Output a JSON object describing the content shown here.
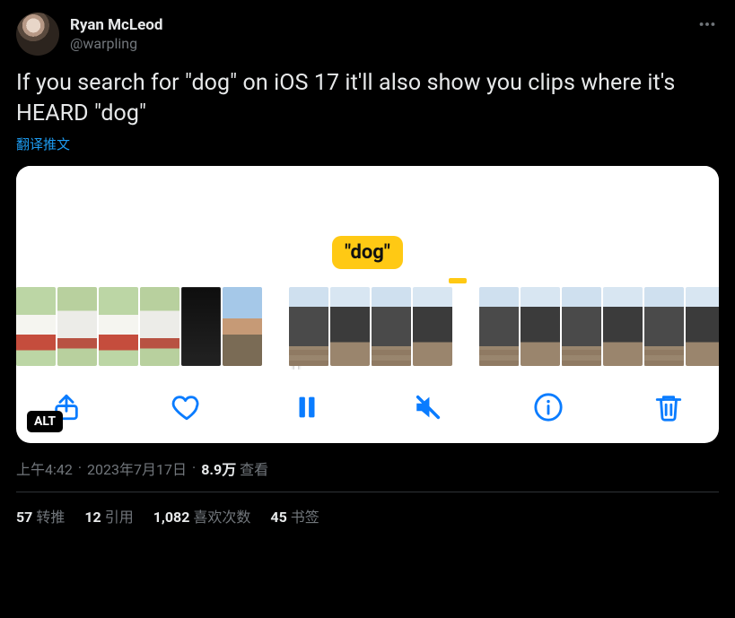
{
  "user": {
    "display_name": "Ryan McLeod",
    "handle": "@warpling"
  },
  "tweet": {
    "text": "If you search for \"dog\" on iOS 17 it'll also show you clips where it's HEARD \"dog\"",
    "translate_label": "翻译推文",
    "tag_label": "\"dog\"",
    "alt_label": "ALT"
  },
  "meta": {
    "time": "上午4:42",
    "date": "2023年7月17日",
    "views_value": "8.9万",
    "views_label": "查看"
  },
  "stats": {
    "retweets": {
      "n": "57",
      "label": "转推"
    },
    "quotes": {
      "n": "12",
      "label": "引用"
    },
    "likes": {
      "n": "1,082",
      "label": "喜欢次数"
    },
    "bookmarks": {
      "n": "45",
      "label": "书签"
    }
  },
  "icons": {
    "share": "share-icon",
    "heart": "heart-icon",
    "pause": "pause-icon",
    "mute": "mute-icon",
    "info": "info-icon",
    "trash": "trash-icon",
    "more": "more-icon"
  }
}
